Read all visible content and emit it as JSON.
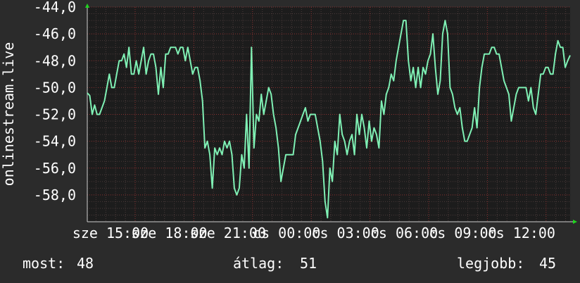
{
  "colors": {
    "background": "#2b2b2b",
    "plot_background": "#1c1c1c",
    "grid_major": "#8a3030",
    "grid_minor": "#4a3a3a",
    "line": "#7ff0b4",
    "text": "#ffffff",
    "arrow": "#1fd61f"
  },
  "chart_data": {
    "type": "line",
    "ylabel": "onlinestream.live",
    "ylim": [
      -60,
      -44
    ],
    "y_ticks": [
      -44,
      -46,
      -48,
      -50,
      -52,
      -54,
      -56,
      -58
    ],
    "y_tick_labels": [
      "-44,0",
      "-46,0",
      "-48,0",
      "-50,0",
      "-52,0",
      "-54,0",
      "-56,0",
      "-58,0"
    ],
    "x_tick_labels": [
      "sze 15:00",
      "sze 18:00",
      "sze 21:00",
      "cs 00:00",
      "cs 03:00",
      "cs 06:00",
      "cs 09:00",
      "cs 12:00"
    ],
    "grid": true,
    "series": [
      {
        "values": [
          -50.4,
          -50.6,
          -52,
          -51.3,
          -52,
          -52,
          -51.5,
          -51,
          -50,
          -49,
          -50,
          -50,
          -49,
          -48,
          -48,
          -47.5,
          -48.5,
          -47,
          -49,
          -49,
          -48,
          -49,
          -48,
          -47,
          -49,
          -48,
          -47.5,
          -47.5,
          -48.5,
          -50.5,
          -48.5,
          -50,
          -47.5,
          -47.5,
          -47,
          -47,
          -47,
          -47.5,
          -47,
          -47,
          -48,
          -47,
          -48,
          -49,
          -48.5,
          -48.5,
          -49.5,
          -51,
          -54.5,
          -54,
          -55,
          -57.5,
          -54.5,
          -55,
          -54.5,
          -55,
          -54,
          -54.5,
          -54,
          -55,
          -57.5,
          -58,
          -57.5,
          -55,
          -56,
          -52,
          -56,
          -47,
          -54.5,
          -52,
          -52.5,
          -50.5,
          -52,
          -51,
          -50,
          -50.5,
          -52,
          -53,
          -54.5,
          -57,
          -56,
          -55,
          -55,
          -55,
          -55,
          -53.5,
          -53,
          -52.5,
          -52,
          -51.5,
          -52.5,
          -52,
          -52,
          -52,
          -53,
          -54,
          -55.5,
          -58.5,
          -59.7,
          -56,
          -57,
          -54,
          -55,
          -52,
          -53.5,
          -54,
          -55,
          -54,
          -53.5,
          -55,
          -52,
          -53.5,
          -52,
          -53,
          -54.5,
          -52.5,
          -54,
          -53,
          -53.5,
          -54.5,
          -51,
          -52,
          -50.5,
          -50,
          -49,
          -49.5,
          -48,
          -47,
          -46,
          -45,
          -45,
          -48,
          -49.5,
          -48.5,
          -50,
          -48.5,
          -50,
          -48.5,
          -49,
          -48,
          -47.5,
          -46,
          -48.5,
          -50.5,
          -49.5,
          -46,
          -45,
          -46,
          -50,
          -50.5,
          -51.5,
          -52,
          -51.5,
          -53,
          -54,
          -54,
          -53.5,
          -53,
          -51.5,
          -53,
          -50,
          -48.5,
          -47.5,
          -47.5,
          -47.5,
          -47,
          -47,
          -47.5,
          -47.5,
          -48.5,
          -49.5,
          -50,
          -50.5,
          -52.5,
          -51.5,
          -50.5,
          -50,
          -50,
          -50,
          -50,
          -51,
          -50,
          -51.5,
          -52,
          -50.5,
          -49,
          -49,
          -48.5,
          -48.5,
          -49,
          -49,
          -47.5,
          -46.5,
          -47,
          -47,
          -48.5,
          -48,
          -47.6
        ]
      }
    ]
  },
  "legend": {
    "current_label": "most:",
    "current_value": "48",
    "average_label": "átlag:",
    "average_value": "51",
    "best_label": "legjobb:",
    "best_value": "45"
  }
}
